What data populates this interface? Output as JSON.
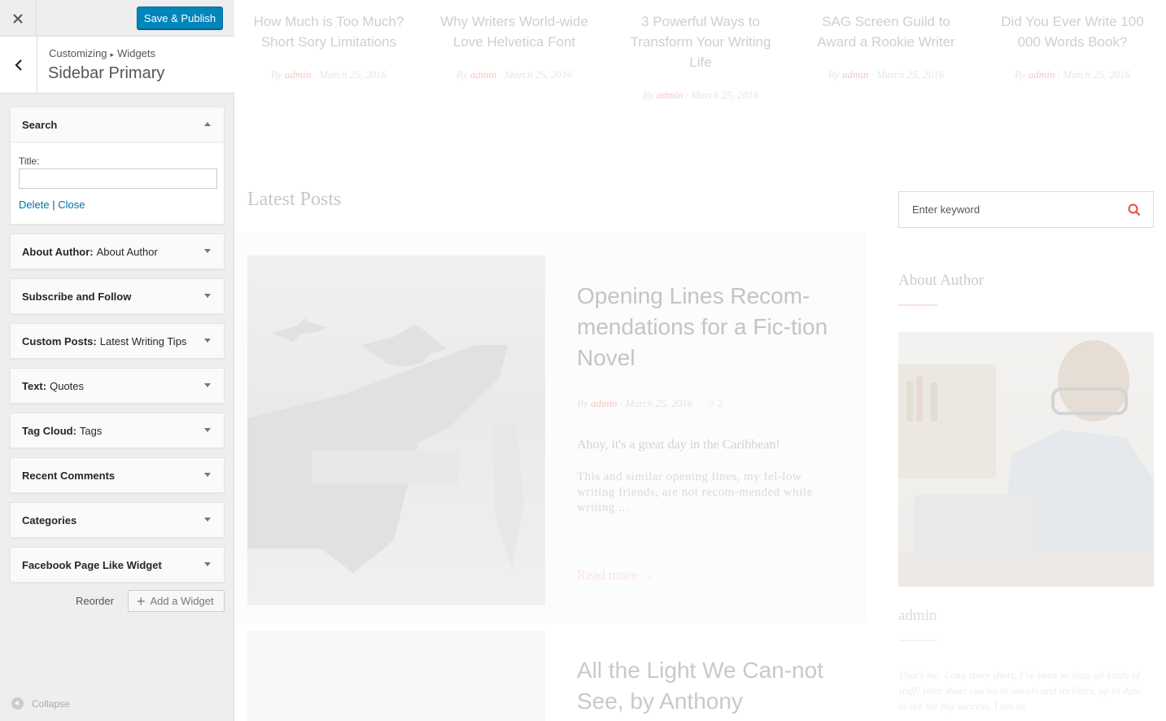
{
  "customizer": {
    "close_icon": "close-icon",
    "publish_label": "Save & Publish",
    "breadcrumb": {
      "root": "Customizing",
      "section": "Widgets"
    },
    "panel_title": "Sidebar Primary",
    "widgets": [
      {
        "title": "Search",
        "subtitle": "",
        "expanded": true
      },
      {
        "title": "About Author:",
        "subtitle": "About Author",
        "expanded": false
      },
      {
        "title": "Subscribe and Follow",
        "subtitle": "",
        "expanded": false
      },
      {
        "title": "Custom Posts:",
        "subtitle": "Latest Writing Tips",
        "expanded": false
      },
      {
        "title": "Text:",
        "subtitle": "Quotes",
        "expanded": false
      },
      {
        "title": "Tag Cloud:",
        "subtitle": "Tags",
        "expanded": false
      },
      {
        "title": "Recent Comments",
        "subtitle": "",
        "expanded": false
      },
      {
        "title": "Categories",
        "subtitle": "",
        "expanded": false
      },
      {
        "title": "Facebook Page Like Widget",
        "subtitle": "",
        "expanded": false
      }
    ],
    "search_widget": {
      "title_label": "Title:",
      "title_value": "",
      "delete_label": "Delete",
      "separator": "|",
      "close_label": "Close"
    },
    "reorder_label": "Reorder",
    "add_widget_label": "Add a Widget",
    "collapse_label": "Collapse",
    "colors": {
      "primary": "#0085ba",
      "link": "#0073aa",
      "panel_bg": "#eeeeee"
    }
  },
  "preview": {
    "top_posts": [
      {
        "title": "How Much is Too Much? Short Sory Limitations",
        "by": "By",
        "author": "admin",
        "date": "March 25, 2016"
      },
      {
        "title": "Why Writers World-wide Love Helvetica Font",
        "by": "By",
        "author": "admin",
        "date": "March 25, 2016"
      },
      {
        "title": "3 Powerful Ways to Transform Your Writing Life",
        "by": "By",
        "author": "admin",
        "date": "March 25, 2016"
      },
      {
        "title": "SAG Screen Guild to Award a Rookie Writer",
        "by": "By",
        "author": "admin",
        "date": "March 25, 2016"
      },
      {
        "title": "Did You Ever Write 100 000 Words Book?",
        "by": "By",
        "author": "admin",
        "date": "March 25, 2016"
      }
    ],
    "latest_heading": "Latest Posts",
    "featured": {
      "title": "Opening Lines Recom-mendations for a Fic-tion Novel",
      "by": "By",
      "author": "admin",
      "date": "March 25, 2016",
      "comments": "2",
      "paragraph1": "Ahoy, it's a great day in the Caribbean!",
      "paragraph2": "This and similar opening lines, my fel-low writing friends, are not recom-mended while writing ...",
      "read_more": "Read more"
    },
    "second_post_title": "All the Light We Can-not See, by Anthony",
    "search_placeholder": "Enter keyword",
    "about_heading": "About Author",
    "author_name": "admin",
    "author_bio": "That's me. Long story short, I've been writing all kinds of stuff: from short stories to novels and thrillers, up to date to see the big success. I am so",
    "colors": {
      "accent": "#e74c3c"
    }
  }
}
